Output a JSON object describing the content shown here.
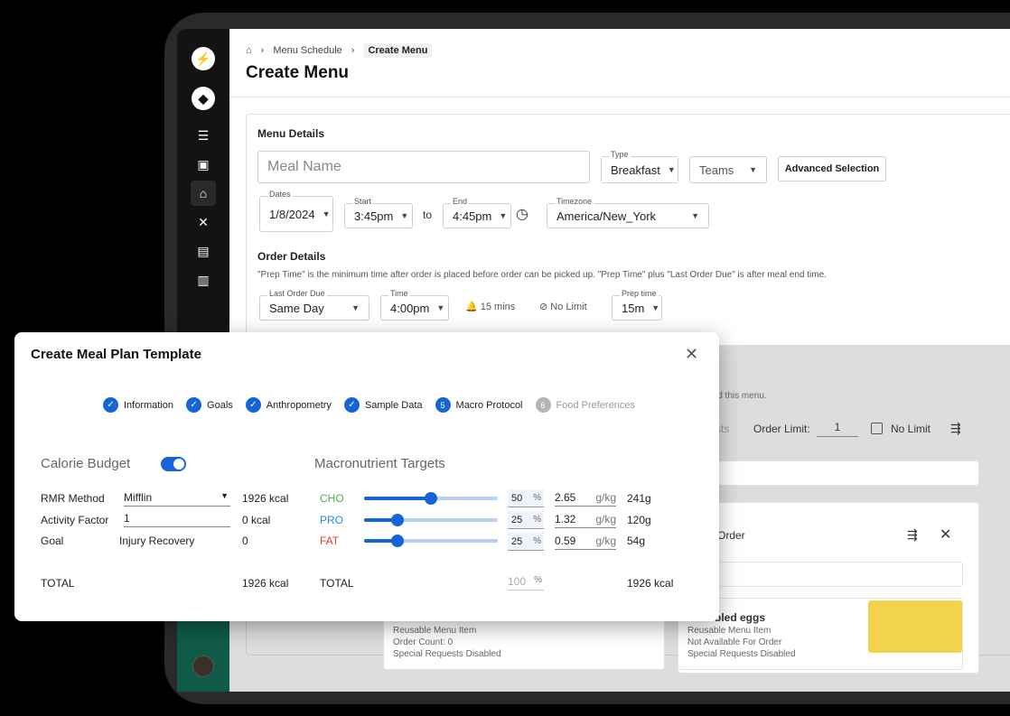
{
  "breadcrumb": {
    "current": "Create Menu",
    "parent": "Menu Schedule"
  },
  "page_title": "Create Menu",
  "menu_details": {
    "heading": "Menu Details",
    "meal_name_placeholder": "Meal Name",
    "type_label": "Type",
    "type_value": "Breakfast",
    "teams_value": "Teams",
    "advanced_selection": "Advanced Selection",
    "dates_label": "Dates",
    "dates_value": "1/8/2024",
    "start_label": "Start",
    "start_value": "3:45pm",
    "to": "to",
    "end_label": "End",
    "end_value": "4:45pm",
    "timezone_label": "Timezone",
    "timezone_value": "America/New_York"
  },
  "order_details": {
    "heading": "Order Details",
    "note": "\"Prep Time\" is the minimum time after order is placed before order can be picked up. \"Prep Time\" plus \"Last Order Due\" is after meal end time.",
    "last_order_due_label": "Last Order Due",
    "last_order_due_value": "Same Day",
    "time_label": "Time",
    "time_value": "4:00pm",
    "reminder": "15 mins",
    "no_limit_text": "No Limit",
    "prep_time_label": "Prep time",
    "prep_time_value": "15m"
  },
  "background_panel": {
    "partial_note": "ld this menu.",
    "partial_tab": "sts",
    "order_limit_label": "Order Limit:",
    "order_limit_value": "1",
    "no_limit_checkbox": "No Limit",
    "section_partial": "Order",
    "card1": {
      "line1": "Reusable Menu Item",
      "line2": "Order Count: 0",
      "line3": "Special Requests Disabled"
    },
    "card2": {
      "title": "bled eggs",
      "line1": "Reusable Menu Item",
      "line2": "Not Available For Order",
      "line3": "Special Requests Disabled"
    }
  },
  "modal": {
    "title": "Create Meal Plan Template",
    "steps": [
      {
        "label": "Information",
        "done": true
      },
      {
        "label": "Goals",
        "done": true
      },
      {
        "label": "Anthropometry",
        "done": true
      },
      {
        "label": "Sample Data",
        "done": true
      },
      {
        "label": "Macro Protocol",
        "number": "5",
        "active": true
      },
      {
        "label": "Food Preferences",
        "number": "6",
        "active": false
      }
    ],
    "calorie_budget": {
      "heading": "Calorie Budget",
      "toggle_on": true,
      "rows": [
        {
          "label": "RMR Method",
          "value": "Mifflin",
          "kcal": "1926 kcal"
        },
        {
          "label": "Activity Factor",
          "value": "1",
          "kcal": "0 kcal"
        },
        {
          "label": "Goal",
          "value": "Injury Recovery",
          "kcal": "0"
        }
      ],
      "total_label": "TOTAL",
      "total_value": "1926 kcal"
    },
    "macros": {
      "heading": "Macronutrient Targets",
      "rows": [
        {
          "name": "CHO",
          "color": "#4caf50",
          "percent": "50",
          "level": 0.5,
          "gkg": "2.65",
          "grams": "241g"
        },
        {
          "name": "PRO",
          "color": "#1e88e5",
          "percent": "25",
          "level": 0.25,
          "gkg": "1.32",
          "grams": "120g"
        },
        {
          "name": "FAT",
          "color": "#e53935",
          "percent": "25",
          "level": 0.25,
          "gkg": "0.59",
          "grams": "54g"
        }
      ],
      "pct_unit": "%",
      "gkg_unit": "g/kg",
      "total_label": "TOTAL",
      "total_percent": "100",
      "total_kcal": "1926 kcal"
    }
  }
}
